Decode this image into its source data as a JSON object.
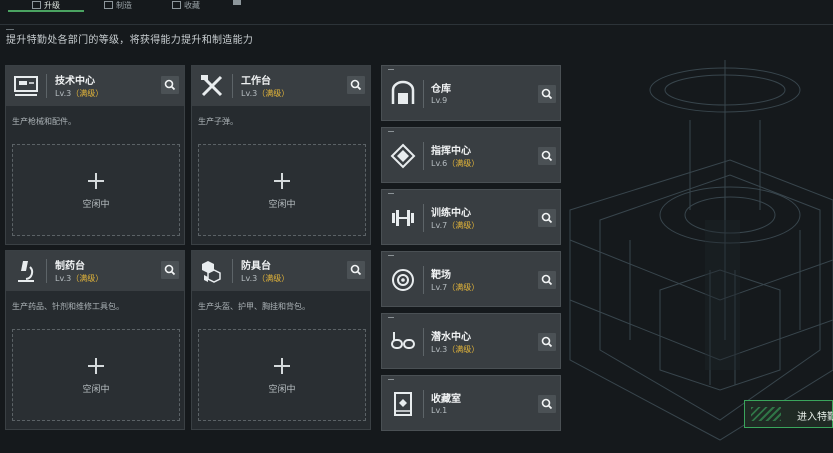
{
  "topbar": {
    "tabs": [
      {
        "label": "升级",
        "icon": "upgrade-icon",
        "active": true
      },
      {
        "label": "制造",
        "icon": "craft-icon",
        "active": false
      },
      {
        "label": "收藏",
        "icon": "collection-icon",
        "active": false
      }
    ]
  },
  "subtitle": "提升特勤处各部门的等级，将获得能力提升和制造能力",
  "work_cards": [
    {
      "name": "技术中心",
      "level": "Lv.3",
      "level_note": "（满级）",
      "icon": "tech-center-icon",
      "desc": "生产枪械和配件。",
      "slot_text": "空闲中"
    },
    {
      "name": "工作台",
      "level": "Lv.3",
      "level_note": "（满级）",
      "icon": "workbench-tools-icon",
      "desc": "生产子弹。",
      "slot_text": "空闲中"
    },
    {
      "name": "制药台",
      "level": "Lv.3",
      "level_note": "（满级）",
      "icon": "microscope-icon",
      "desc": "生产药品、针剂和维修工具包。",
      "slot_text": "空闲中"
    },
    {
      "name": "防具台",
      "level": "Lv.3",
      "level_note": "（满级）",
      "icon": "armor-boxes-icon",
      "desc": "生产头盔、护甲、胸挂和背包。",
      "slot_text": "空闲中"
    }
  ],
  "facilities": [
    {
      "name": "仓库",
      "level": "Lv.9",
      "level_note": "",
      "icon": "warehouse-icon"
    },
    {
      "name": "指挥中心",
      "level": "Lv.6",
      "level_note": "（满级）",
      "icon": "chip-icon"
    },
    {
      "name": "训练中心",
      "level": "Lv.7",
      "level_note": "（满级）",
      "icon": "dumbbell-icon"
    },
    {
      "name": "靶场",
      "level": "Lv.7",
      "level_note": "（满级）",
      "icon": "target-icon"
    },
    {
      "name": "潜水中心",
      "level": "Lv.3",
      "level_note": "（满级）",
      "icon": "diving-goggles-icon"
    },
    {
      "name": "收藏室",
      "level": "Lv.1",
      "level_note": "",
      "icon": "collection-cabinet-icon"
    }
  ],
  "enter_button": {
    "label": "进入特勤"
  },
  "colors": {
    "accent_green": "#3aa55c",
    "level_note": "#e3b53a",
    "background": "#15191c"
  }
}
